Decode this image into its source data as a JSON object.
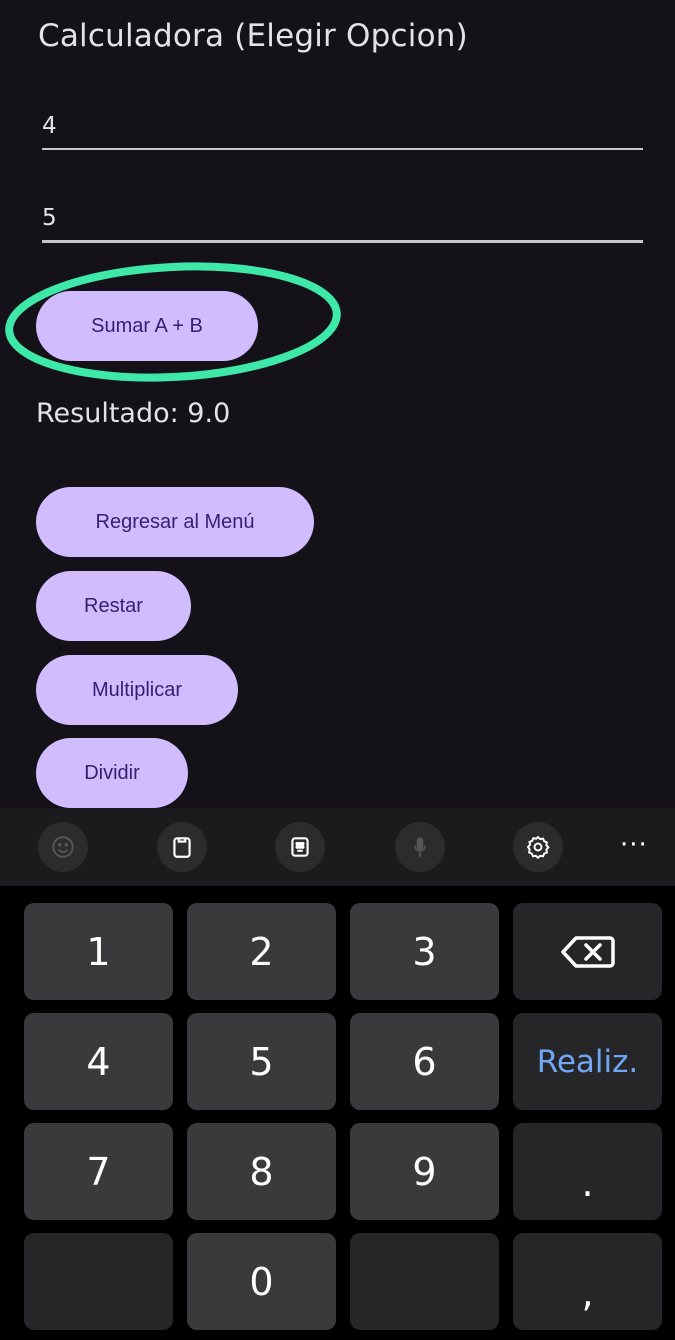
{
  "app": {
    "title": "Calculadora (Elegir Opcion)",
    "input_a": "4",
    "input_b": "5",
    "sum_button": "Sumar A + B",
    "result": "Resultado: 9.0",
    "menu_button": "Regresar al Menú",
    "subtract_button": "Restar",
    "multiply_button": "Multiplicar",
    "divide_button": "Dividir"
  },
  "toolbar": {
    "icons": [
      "emoji-icon",
      "clipboard-icon",
      "keypad-icon",
      "microphone-icon",
      "settings-icon",
      "more-icon"
    ],
    "more_label": "···"
  },
  "keyboard": {
    "rows": [
      [
        "1",
        "2",
        "3",
        "backspace"
      ],
      [
        "4",
        "5",
        "6",
        "Realiz."
      ],
      [
        "7",
        "8",
        "9",
        "."
      ],
      [
        "",
        "0",
        "",
        ","
      ]
    ],
    "key_1": "1",
    "key_2": "2",
    "key_3": "3",
    "key_4": "4",
    "key_5": "5",
    "key_6": "6",
    "key_7": "7",
    "key_8": "8",
    "key_9": "9",
    "key_0": "0",
    "done": "Realiz.",
    "dot": ".",
    "comma": ","
  },
  "colors": {
    "background": "#141218",
    "button": "#d0bcff",
    "button_text": "#381e72",
    "annotation_ring": "#3ee8a8",
    "done_key": "#6ea7f5"
  }
}
